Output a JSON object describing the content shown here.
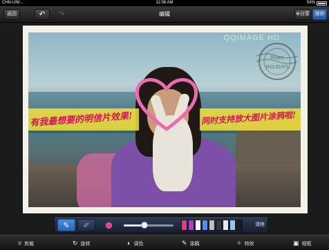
{
  "status_bar": {
    "carrier": "CHN-UNI...",
    "time": "11:06 AM",
    "battery": "54%"
  },
  "nav": {
    "back_label": "返回",
    "undo_icon": "undo-arrow-icon",
    "redo_icon": "redo-arrow-icon",
    "title": "编辑",
    "share_label": "分享",
    "save_label": "保存"
  },
  "photo": {
    "watermark": "QQIMAGE HD",
    "stamp_text": "Happy HOLIDAYS",
    "caption_left": "有我最想要的明信片效果!",
    "caption_right": "同时支持放大图片涂鸦啦!"
  },
  "draw_toolbar": {
    "pen_icon": "pen-icon",
    "eraser_icon": "eraser-icon",
    "current_color": "#e83a8c",
    "brush_size_fraction": 0.42,
    "palette": [
      "#e83a8c",
      "#b03ad4",
      "#ffffff",
      "#5a8cf0",
      "#c0c0c0",
      "#3a3a3a",
      "#e8e8e8",
      "#8dc8f0",
      "#1a1a1a"
    ],
    "clear_label": "清除"
  },
  "bottom_toolbar": {
    "items": [
      {
        "label": "剪裁",
        "icon": "crop-icon"
      },
      {
        "label": "旋转",
        "icon": "rotate-icon"
      },
      {
        "label": "调色",
        "icon": "color-adjust-icon"
      },
      {
        "label": "涂鸦",
        "icon": "doodle-icon"
      },
      {
        "label": "特效",
        "icon": "effects-icon"
      },
      {
        "label": "相框",
        "icon": "frame-icon"
      }
    ],
    "active_index": 3
  }
}
